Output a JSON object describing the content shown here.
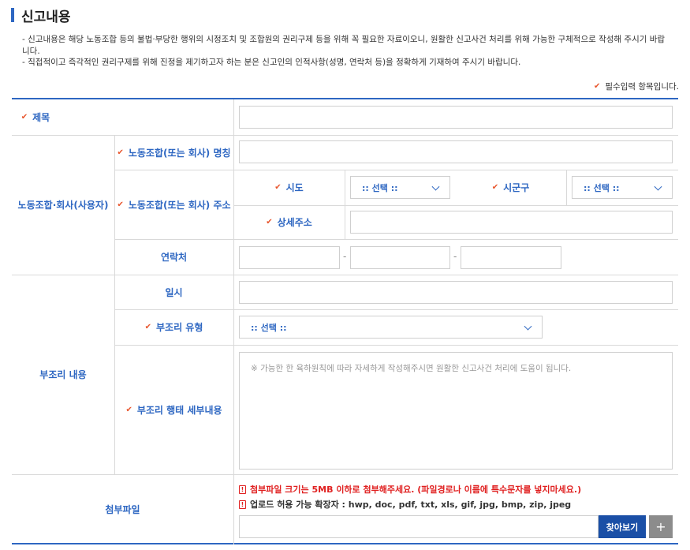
{
  "title": "신고내용",
  "notice": [
    "- 신고내용은 해당 노동조합 등의 불법·부당한 행위의 시정조치 및 조합원의 권리구제 등을 위해 꼭 필요한 자료이오니, 원활한 신고사건 처리를 위해 가능한 구체적으로 작성해 주시기 바랍니다.",
    "- 직접적이고 즉각적인 권리구제를 위해 진정을 제기하고자 하는 분은 신고인의 인적사항(성명, 연락처 등)을 정확하게 기재하여 주시기 바랍니다."
  ],
  "required_note": "필수입력 항목입니다.",
  "labels": {
    "subject": "제목",
    "org_group": "노동조합·회사(사용자)",
    "org_name": "노동조합(또는 회사) 명칭",
    "org_address": "노동조합(또는 회사) 주소",
    "sido": "시도",
    "sigungu": "시군구",
    "detail_address": "상세주소",
    "contact": "연락처",
    "injustice_group": "부조리 내용",
    "datetime": "일시",
    "injustice_type": "부조리 유형",
    "injustice_detail": "부조리 행태 세부내용",
    "attachment": "첨부파일"
  },
  "selects": {
    "sido": ":: 선택 ::",
    "sigungu": ":: 선택 ::",
    "injustice_type": ":: 선택 ::"
  },
  "contact_separator": "-",
  "detail_placeholder": "※ 가능한 한 육하원칙에 따라 자세하게 작성해주시면 원활한 신고사건 처리에 도움이 됩니다.",
  "file_notes": {
    "size": "첨부파일 크기는 5MB 이하로 첨부해주세요. (파일경로나 이름에 특수문자를 넣지마세요.)",
    "extensions": "업로드 허용 가능 확장자 : hwp, doc, pdf, txt, xls, gif, jpg, bmp, zip, jpeg"
  },
  "buttons": {
    "find": "찾아보기",
    "add": "+"
  },
  "colors": {
    "accent": "#2e67c2",
    "required": "#e8552c",
    "warning": "#e02020",
    "button": "#1a4fa6"
  }
}
